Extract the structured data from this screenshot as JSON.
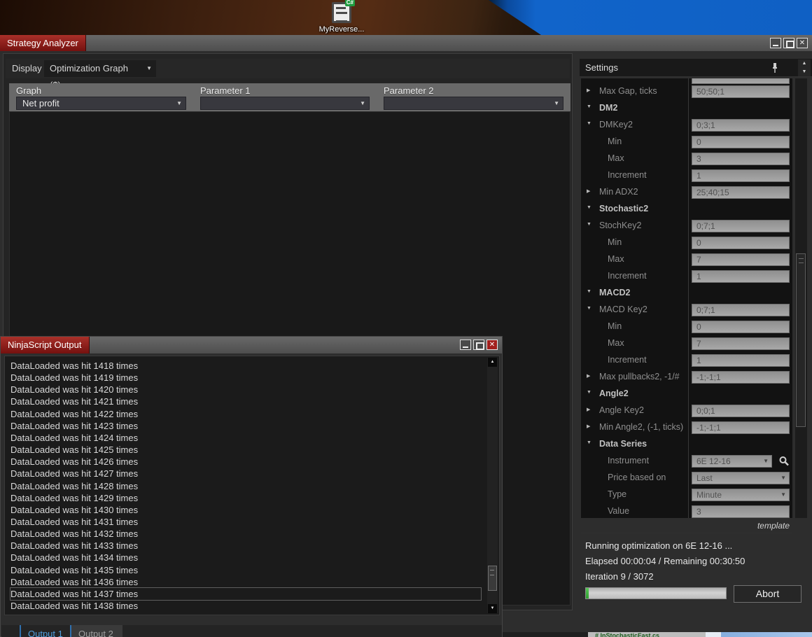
{
  "colors": {
    "title_tab_red": "#8f1a18",
    "desktop_blue": "#1164ca",
    "progress_green": "#2f9e2f"
  },
  "desktop": {
    "icon_label": "MyReverse...",
    "icon_badge": "C#"
  },
  "strategy_analyzer": {
    "title": "Strategy Analyzer",
    "display": {
      "label": "Display",
      "value": "Optimization Graph ($)"
    },
    "graph_selector": {
      "columns": [
        {
          "label": "Graph",
          "value": "Net profit"
        },
        {
          "label": "Parameter 1",
          "value": ""
        },
        {
          "label": "Parameter 2",
          "value": ""
        }
      ]
    }
  },
  "settings": {
    "title": "Settings",
    "rows": [
      {
        "type": "property",
        "indent": 1,
        "arrow": "collapsed",
        "label": "Max Gap, ticks",
        "value": "50;50;1"
      },
      {
        "type": "group",
        "arrow": "expanded",
        "label": "DM2"
      },
      {
        "type": "property",
        "indent": 1,
        "arrow": "expanded",
        "label": "DMKey2",
        "value": "0;3;1"
      },
      {
        "type": "property",
        "indent": 2,
        "label": "Min",
        "value": "0"
      },
      {
        "type": "property",
        "indent": 2,
        "label": "Max",
        "value": "3"
      },
      {
        "type": "property",
        "indent": 2,
        "label": "Increment",
        "value": "1"
      },
      {
        "type": "property",
        "indent": 1,
        "arrow": "collapsed",
        "label": "Min ADX2",
        "value": "25;40;15"
      },
      {
        "type": "group",
        "arrow": "expanded",
        "label": "Stochastic2"
      },
      {
        "type": "property",
        "indent": 1,
        "arrow": "expanded",
        "label": "StochKey2",
        "value": "0;7;1"
      },
      {
        "type": "property",
        "indent": 2,
        "label": "Min",
        "value": "0"
      },
      {
        "type": "property",
        "indent": 2,
        "label": "Max",
        "value": "7"
      },
      {
        "type": "property",
        "indent": 2,
        "label": "Increment",
        "value": "1"
      },
      {
        "type": "group",
        "arrow": "expanded",
        "label": "MACD2"
      },
      {
        "type": "property",
        "indent": 1,
        "arrow": "expanded",
        "label": "MACD Key2",
        "value": "0;7;1"
      },
      {
        "type": "property",
        "indent": 2,
        "label": "Min",
        "value": "0"
      },
      {
        "type": "property",
        "indent": 2,
        "label": "Max",
        "value": "7"
      },
      {
        "type": "property",
        "indent": 2,
        "label": "Increment",
        "value": "1"
      },
      {
        "type": "property",
        "indent": 1,
        "arrow": "collapsed",
        "label": "Max pullbacks2, -1/#",
        "value": "-1;-1;1"
      },
      {
        "type": "group",
        "arrow": "expanded",
        "label": "Angle2"
      },
      {
        "type": "property",
        "indent": 1,
        "arrow": "collapsed",
        "label": "Angle Key2",
        "value": "0;0;1"
      },
      {
        "type": "property",
        "indent": 1,
        "arrow": "collapsed",
        "label": "Min Angle2, (-1, ticks)",
        "value": "-1;-1;1"
      },
      {
        "type": "group",
        "arrow": "expanded",
        "label": "Data Series"
      },
      {
        "type": "property",
        "indent": 2,
        "label": "Instrument",
        "value": "6E 12-16",
        "control": "combo-search"
      },
      {
        "type": "property",
        "indent": 2,
        "label": "Price based on",
        "value": "Last",
        "control": "combo"
      },
      {
        "type": "property",
        "indent": 2,
        "label": "Type",
        "value": "Minute",
        "control": "combo"
      },
      {
        "type": "property",
        "indent": 2,
        "label": "Value",
        "value": "3"
      }
    ],
    "template_link": "template",
    "status": {
      "line1": "Running optimization on 6E 12-16 ...",
      "line2": "Elapsed 00:00:04 / Remaining 00:30:50",
      "line3": "Iteration 9 / 3072",
      "abort_label": "Abort",
      "progress_percent": 2
    }
  },
  "ninjascript_output": {
    "title": "NinjaScript Output",
    "lines": [
      "DataLoaded was hit 1418 times",
      "DataLoaded was hit 1419 times",
      "DataLoaded was hit 1420 times",
      "DataLoaded was hit 1421 times",
      "DataLoaded was hit 1422 times",
      "DataLoaded was hit 1423 times",
      "DataLoaded was hit 1424 times",
      "DataLoaded was hit 1425 times",
      "DataLoaded was hit 1426 times",
      "DataLoaded was hit 1427 times",
      "DataLoaded was hit 1428 times",
      "DataLoaded was hit 1429 times",
      "DataLoaded was hit 1430 times",
      "DataLoaded was hit 1431 times",
      "DataLoaded was hit 1432 times",
      "DataLoaded was hit 1433 times",
      "DataLoaded was hit 1434 times",
      "DataLoaded was hit 1435 times",
      "DataLoaded was hit 1436 times",
      "DataLoaded was hit 1437 times",
      "DataLoaded was hit 1438 times"
    ],
    "focused_line_index": 19,
    "tabs": [
      {
        "label": "Output 1",
        "active": true
      },
      {
        "label": "Output 2",
        "active": false
      }
    ]
  },
  "background_windows": {
    "code_file_tab": "# InStochasticFast.cs"
  }
}
